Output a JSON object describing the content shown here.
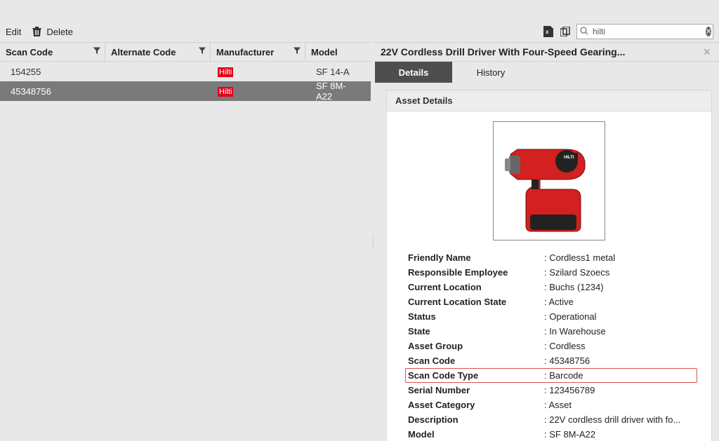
{
  "toolbar": {
    "edit_label": "Edit",
    "delete_label": "Delete"
  },
  "search": {
    "value": "hilti"
  },
  "table": {
    "headers": {
      "scan_code": "Scan Code",
      "alternate_code": "Alternate Code",
      "manufacturer": "Manufacturer",
      "model": "Model"
    },
    "rows": [
      {
        "scan_code": "154255",
        "alternate_code": "",
        "manufacturer": "Hilti",
        "model": "SF 14-A",
        "selected": false
      },
      {
        "scan_code": "45348756",
        "alternate_code": "",
        "manufacturer": "Hilti",
        "model": "SF 8M-A22",
        "selected": true
      }
    ]
  },
  "detail": {
    "title": "22V Cordless Drill Driver With Four-Speed Gearing...",
    "tabs": {
      "details": "Details",
      "history": "History"
    },
    "card_title": "Asset Details",
    "props": [
      {
        "label": "Friendly Name",
        "value": ": Cordless1 metal"
      },
      {
        "label": "Responsible Employee",
        "value": ": Szilard Szoecs"
      },
      {
        "label": "Current Location",
        "value": ": Buchs (1234)"
      },
      {
        "label": "Current Location State",
        "value": ": Active"
      },
      {
        "label": "Status",
        "value": ": Operational"
      },
      {
        "label": "State",
        "value": ": In Warehouse"
      },
      {
        "label": "Asset Group",
        "value": ": Cordless"
      },
      {
        "label": "Scan Code",
        "value": ": 45348756"
      },
      {
        "label": "Scan Code Type",
        "value": ": Barcode",
        "highlight": true
      },
      {
        "label": "Serial Number",
        "value": ": 123456789"
      },
      {
        "label": "Asset Category",
        "value": ": Asset"
      },
      {
        "label": "Description",
        "value": ": 22V cordless drill driver with fo..."
      },
      {
        "label": "Model",
        "value": ": SF 8M-A22"
      }
    ]
  }
}
